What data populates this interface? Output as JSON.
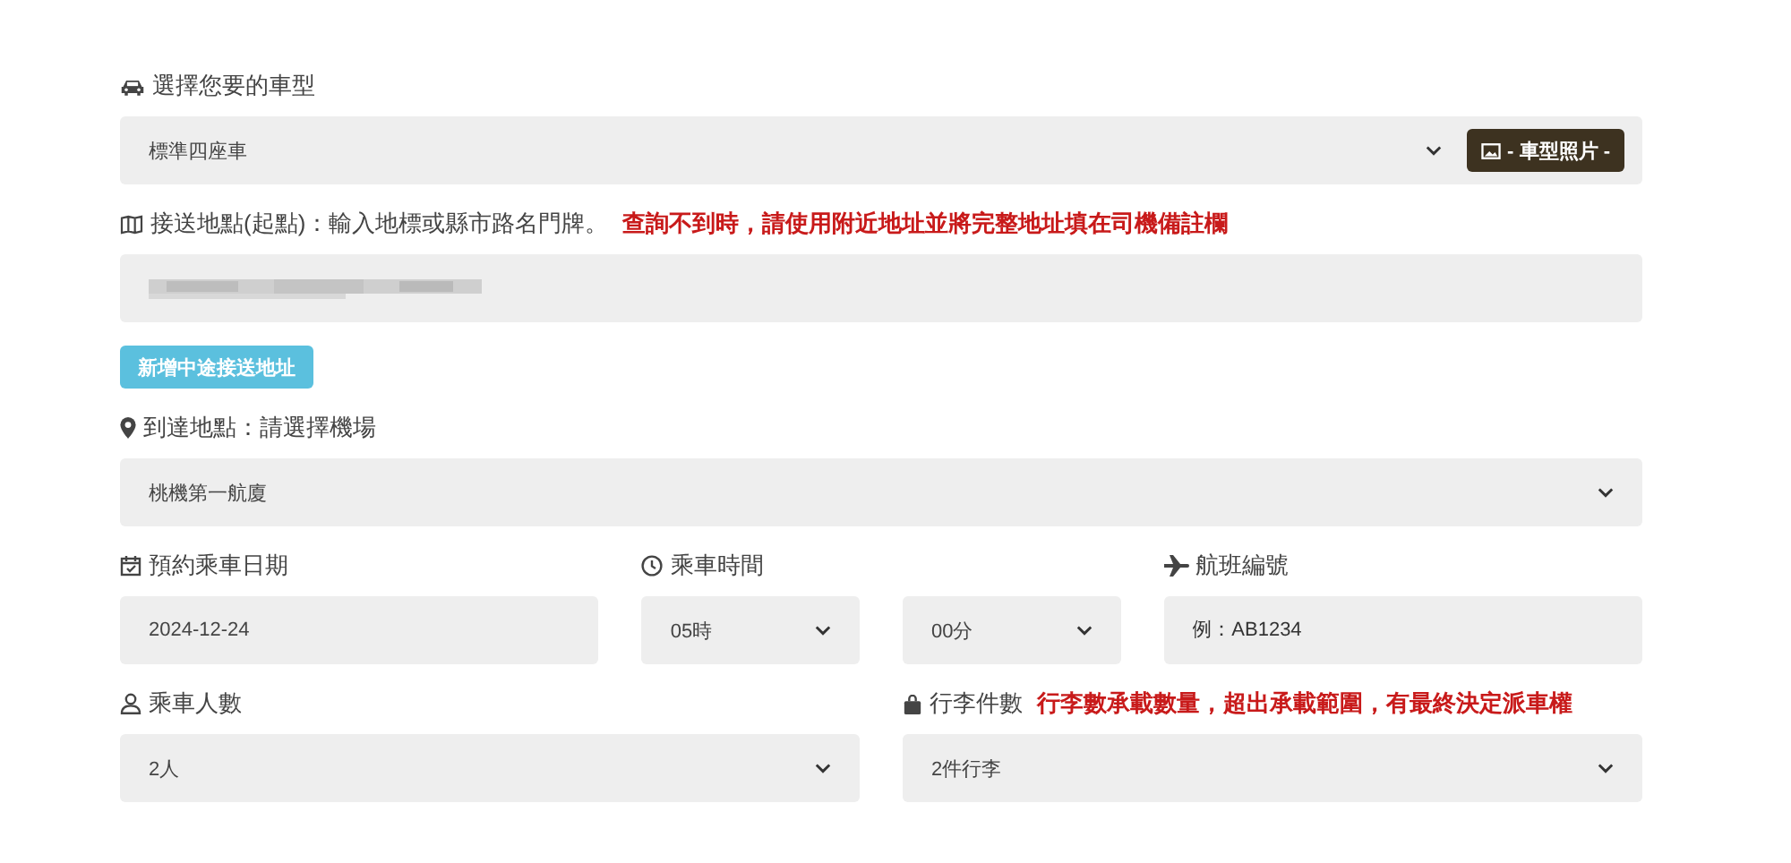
{
  "vehicle": {
    "label": "選擇您要的車型",
    "value": "標準四座車",
    "photo_button": "- 車型照片 -"
  },
  "pickup": {
    "label": "接送地點(起點)：輸入地標或縣市路名門牌。",
    "note": "查詢不到時，請使用附近地址並將完整地址填在司機備註欄",
    "add_stop_button": "新增中途接送地址"
  },
  "destination": {
    "label": "到達地點：請選擇機場",
    "value": "桃機第一航廈"
  },
  "date": {
    "label": "預約乘車日期",
    "value": "2024-12-24"
  },
  "time": {
    "label": "乘車時間",
    "hour": "05時",
    "minute": "00分"
  },
  "flight": {
    "label": "航班編號",
    "placeholder": "例：AB1234"
  },
  "passengers": {
    "label": "乘車人數",
    "value": "2人"
  },
  "luggage": {
    "label": "行李件數",
    "note": "行李數承載數量，超出承載範圍，有最終決定派車權",
    "value": "2件行李"
  }
}
